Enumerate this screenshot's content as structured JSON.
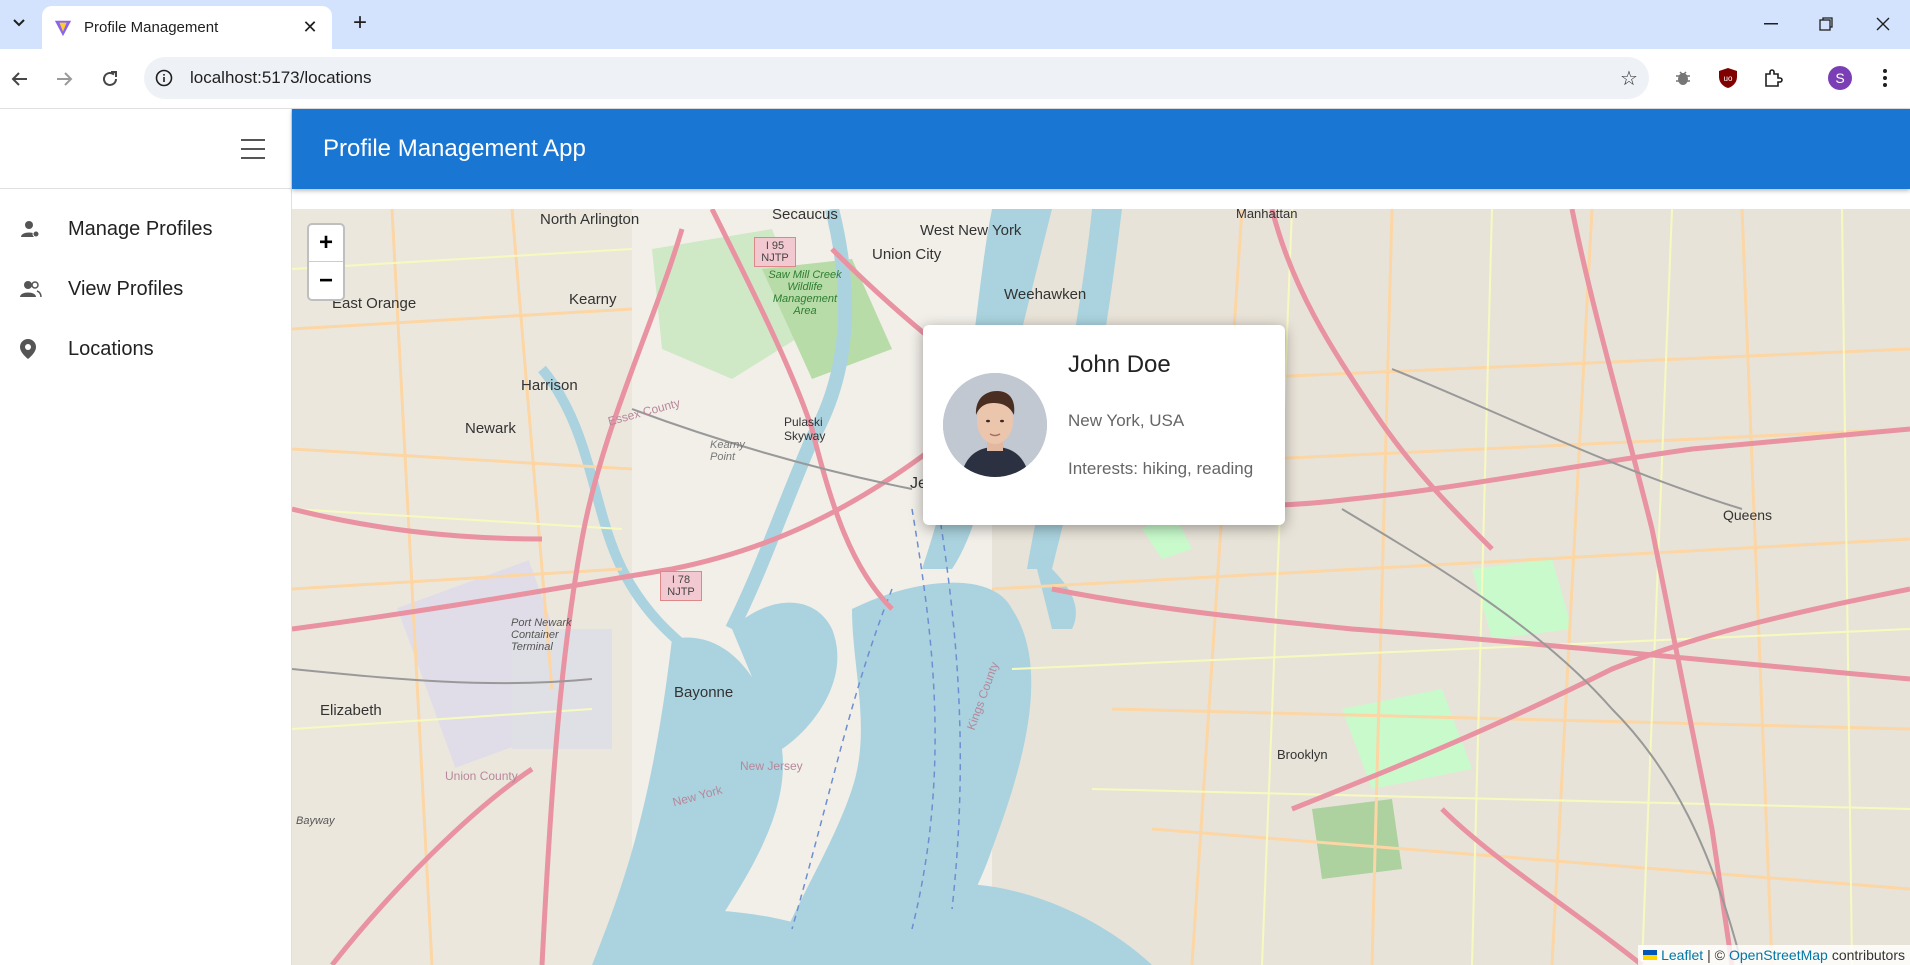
{
  "browser": {
    "tab_title": "Profile Management",
    "url": "localhost:5173/locations",
    "profile_initial": "S"
  },
  "app": {
    "title": "Profile Management App",
    "nav": [
      {
        "label": "Manage Profiles",
        "icon": "manage-profiles-icon"
      },
      {
        "label": "View Profiles",
        "icon": "people-icon"
      },
      {
        "label": "Locations",
        "icon": "location-pin-icon"
      }
    ]
  },
  "map": {
    "zoom_in": "+",
    "zoom_out": "−",
    "place_labels": [
      "North Arlington",
      "Secaucus",
      "West New York",
      "Manhattan",
      "Union City",
      "Weehawken",
      "East Orange",
      "Kearny",
      "Harrison",
      "Newark",
      "Pulaski Skyway",
      "Kearny Point",
      "Jersey City",
      "New York",
      "Queens",
      "Bayonne",
      "Elizabeth",
      "Brooklyn",
      "Port Newark Container Terminal",
      "Saw Mill Creek Wildlife Management Area",
      "Essex County",
      "Kings County",
      "Union County",
      "New Jersey",
      "New York",
      "Bayway"
    ],
    "highway_shields": [
      "I 95 NJTP",
      "I 78 NJTP"
    ],
    "attribution": {
      "leaflet": "Leaflet",
      "separator": "| ©",
      "osm": "OpenStreetMap",
      "suffix": "contributors"
    },
    "colors": {
      "water": "#aad3df",
      "land": "#f2efe9",
      "major_road": "#e892a2",
      "secondary_road": "#fcd6a4",
      "park": "#c8facc",
      "marker": "#2a81cb"
    }
  },
  "popup": {
    "name": "John Doe",
    "location": "New York, USA",
    "interests": "Interests: hiking, reading"
  },
  "colors": {
    "appbar": "#1976d2",
    "tabbar": "#d3e3fd"
  }
}
